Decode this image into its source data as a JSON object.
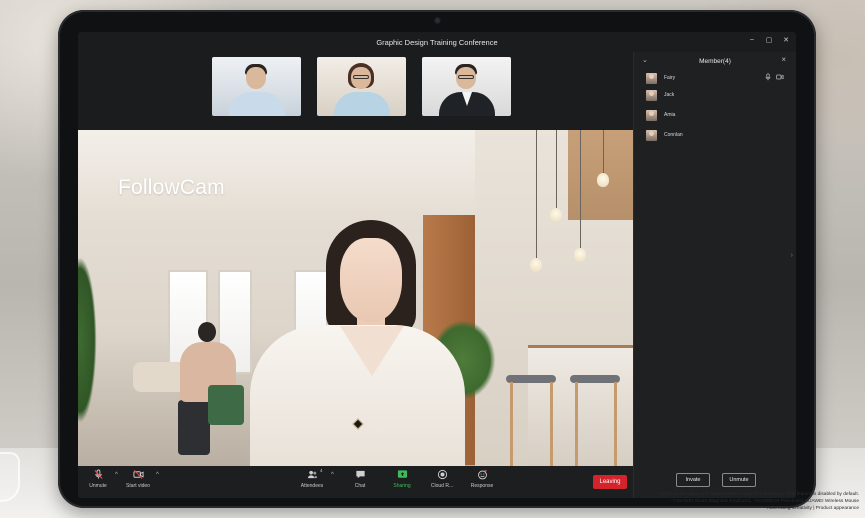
{
  "window": {
    "title": "Graphic Design Training Conference",
    "controls": [
      "–",
      "▢",
      "✕"
    ]
  },
  "main_video": {
    "overlay_label": "FollowCam"
  },
  "participants_strip": {
    "count_shown": 3
  },
  "members_panel": {
    "title": "Member(4)",
    "members": [
      {
        "name": "Fairy",
        "mic": true,
        "camera": true
      },
      {
        "name": "Jack"
      },
      {
        "name": "Amia"
      },
      {
        "name": "Connlan"
      }
    ],
    "invite_label": "Invate",
    "unmute_label": "Unmute"
  },
  "toolbar": {
    "unmute_label": "Unmute",
    "start_video_label": "Start video",
    "attendees_label": "Attendees",
    "attendees_count": "4",
    "chat_label": "Chat",
    "sharing_label": "Sharing",
    "cloud_label": "Cloud R...",
    "response_label": "Response",
    "leaving_label": "Leaving"
  },
  "colors": {
    "accent_sharing": "#3dbb5a",
    "leaving_red": "#d4232a",
    "panel_bg": "#1f2022"
  },
  "disclaimer": {
    "line1": "* Only certain apps and Huawei tablets support this feature. This feature is disabled by default.",
    "line2": "* HUAWEI Smart Magnetic Keyboard、HUAWEI M-Pencil and HUAWEI Wireless Mouse",
    "line3": "Advertising Creativity | Product appearance"
  }
}
